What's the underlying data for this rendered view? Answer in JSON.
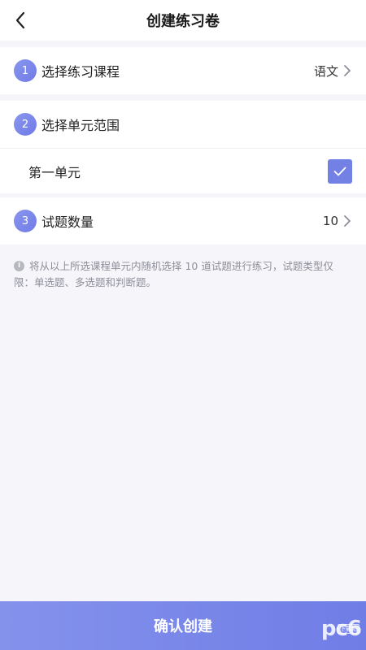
{
  "header": {
    "title": "创建练习卷"
  },
  "steps": [
    {
      "number": "1",
      "label": "选择练习课程",
      "value": "语文"
    },
    {
      "number": "2",
      "label": "选择单元范围"
    },
    {
      "number": "3",
      "label": "试题数量",
      "value": "10"
    }
  ],
  "unit": {
    "label": "第一单元",
    "checked": true
  },
  "note": {
    "text": "将从以上所选课程单元内随机选择 10 道试题进行练习，试题类型仅限：单选题、多选题和判断题。"
  },
  "footer": {
    "confirm_label": "确认创建"
  },
  "watermark": {
    "text": "pc6",
    "sub": "下载站"
  },
  "colors": {
    "accent": "#7381e4",
    "background": "#f6f6fa"
  }
}
